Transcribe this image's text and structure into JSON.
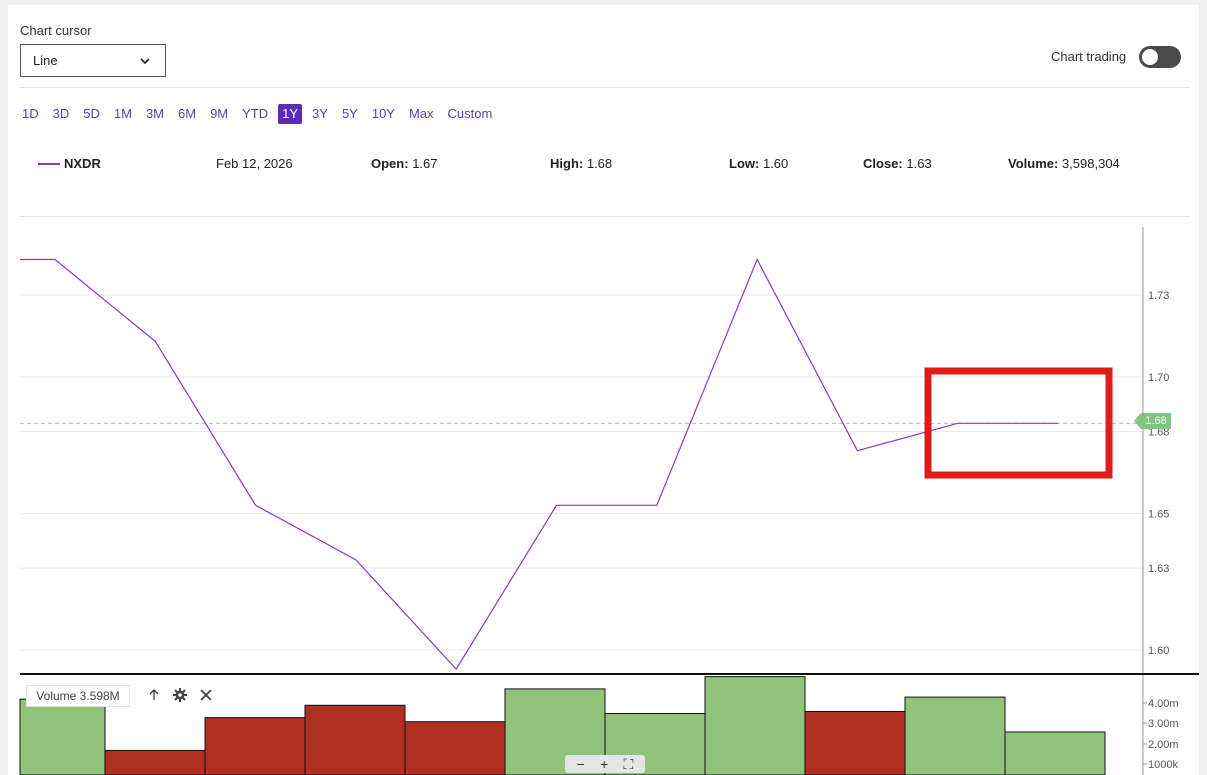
{
  "controls": {
    "cursor_label": "Chart cursor",
    "cursor_value": "Line",
    "chart_trading_label": "Chart trading",
    "chart_trading_on": false
  },
  "ranges": [
    "1D",
    "3D",
    "5D",
    "1M",
    "3M",
    "6M",
    "9M",
    "YTD",
    "1Y",
    "3Y",
    "5Y",
    "10Y",
    "Max",
    "Custom"
  ],
  "active_range": "1Y",
  "legend": {
    "symbol": "NXDR",
    "date": "Feb 12, 2026",
    "open_label": "Open:",
    "open": "1.67",
    "high_label": "High:",
    "high": "1.68",
    "low_label": "Low:",
    "low": "1.60",
    "close_label": "Close:",
    "close": "1.63",
    "volume_label": "Volume:",
    "volume": "3,598,304"
  },
  "volume_panel": {
    "label": "Volume 3.598M",
    "axis_ticks": [
      "4.00m",
      "3.00m",
      "2.00m",
      "1000k"
    ]
  },
  "price_marker": "1.68",
  "colors": {
    "line": "#8a3bbf",
    "up": "#8fc47a",
    "down": "#b0301f",
    "accent": "#5b2bb5",
    "highlight": "#e01b1b"
  },
  "chart_data": {
    "type": "line",
    "series": [
      {
        "name": "NXDR",
        "values": [
          1.743,
          1.743,
          1.713,
          1.653,
          1.633,
          1.593,
          1.653,
          1.653,
          1.743,
          1.673,
          1.683,
          1.683
        ]
      }
    ],
    "y_ticks": [
      1.73,
      1.7,
      1.68,
      1.65,
      1.63,
      1.6
    ],
    "y_tick_labels": [
      "1.73",
      "1.70",
      "1.68",
      "1.65",
      "1.63",
      "1.60"
    ],
    "ylim": [
      1.59,
      1.75
    ],
    "reference_value": 1.683,
    "volume": [
      {
        "value": 3.7,
        "dir": "up"
      },
      {
        "value": 1.2,
        "dir": "down"
      },
      {
        "value": 2.8,
        "dir": "down"
      },
      {
        "value": 3.4,
        "dir": "down"
      },
      {
        "value": 2.6,
        "dir": "down"
      },
      {
        "value": 4.2,
        "dir": "up"
      },
      {
        "value": 3.0,
        "dir": "up"
      },
      {
        "value": 4.8,
        "dir": "up"
      },
      {
        "value": 3.1,
        "dir": "down"
      },
      {
        "value": 3.8,
        "dir": "up"
      },
      {
        "value": 2.1,
        "dir": "up"
      }
    ],
    "grid": true
  }
}
